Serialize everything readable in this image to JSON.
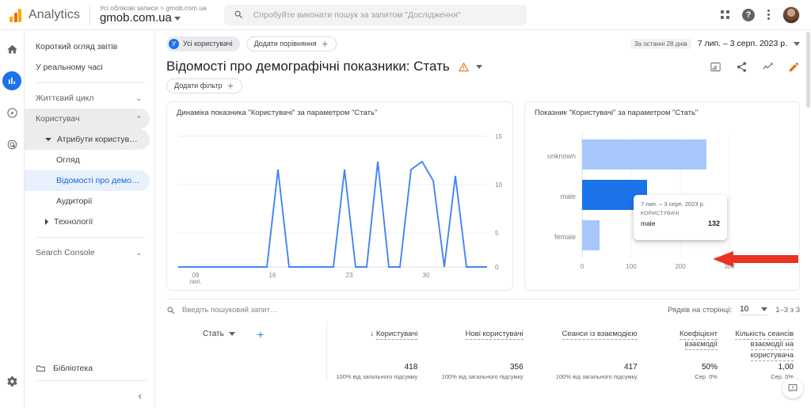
{
  "topbar": {
    "brand": "Analytics",
    "account_crumb": "Усі облікові записи > gmob.com.ua",
    "property": "gmob.com.ua",
    "search_placeholder": "Спробуйте виконати пошук за запитом \"Дослідження\"",
    "search_icon": "search-icon",
    "apps_icon": "apps-grid-icon",
    "help_icon": "help-icon",
    "more_icon": "more-options-icon",
    "avatar": "user-avatar"
  },
  "rail": {
    "items": [
      {
        "name": "home-icon",
        "label": "Головна"
      },
      {
        "name": "reports-icon",
        "label": "Звіти",
        "active": true
      },
      {
        "name": "explore-icon",
        "label": "Дослідження"
      },
      {
        "name": "advertising-icon",
        "label": "Реклама"
      }
    ],
    "settings_icon": "gear-icon"
  },
  "nav": {
    "items": [
      {
        "label": "Короткий огляд звітів",
        "style": "plain"
      },
      {
        "label": "У реальному часі",
        "style": "plain"
      },
      {
        "label": "Життєвий цикл",
        "style": "group",
        "chevron": "⌄"
      },
      {
        "label": "Користувач",
        "style": "group-selected",
        "chevron": "⌃"
      },
      {
        "label": "Атрибути користувача",
        "style": "sub-selected",
        "tri": "down"
      },
      {
        "label": "Огляд",
        "style": "leaf"
      },
      {
        "label": "Відомості про демографіч…",
        "style": "leaf-active"
      },
      {
        "label": "Аудиторії",
        "style": "leaf"
      },
      {
        "label": "Технології",
        "style": "sub",
        "tri": "right"
      },
      {
        "label": "Search Console",
        "style": "group",
        "chevron": "⌄"
      }
    ],
    "library_label": "Бібліотека",
    "library_icon": "folder-icon",
    "collapse_icon": "collapse-left-icon"
  },
  "toolbar": {
    "all_users_chip": "Усі користувачі",
    "all_users_badge": "У",
    "add_comparison": "Додати порівняння",
    "add_comparison_icon": "plus-icon",
    "date_badge": "За останні 28 днів",
    "date_range": "7 лип. – 3 серп. 2023 р.",
    "date_caret": "chevron-down-icon"
  },
  "header": {
    "title": "Відомості про демографічні показники: Стать",
    "warning_icon": "warning-triangle-icon",
    "title_caret": "chevron-down-icon",
    "add_filter": "Додати фільтр",
    "add_filter_icon": "plus-icon",
    "actions": [
      {
        "name": "insights-icon"
      },
      {
        "name": "share-icon"
      },
      {
        "name": "compare-icon"
      },
      {
        "name": "edit-icon"
      }
    ]
  },
  "chart_data": [
    {
      "type": "line",
      "title": "Динаміка показника \"Користувачі\" за параметром \"Стать\"",
      "xlabel": "",
      "ylabel": "",
      "ylim": [
        0,
        15
      ],
      "yticks": [
        0,
        5,
        10,
        15
      ],
      "xticks": [
        "09",
        "16",
        "23",
        "30"
      ],
      "xtick_sub": "лип.",
      "series": [
        {
          "name": "Користувачі",
          "color": "#4285f4",
          "values": [
            0,
            0,
            0,
            0,
            0,
            0,
            0,
            0,
            0,
            10,
            0,
            0,
            0,
            0,
            0,
            10,
            0,
            0,
            11,
            0,
            0,
            10,
            11,
            9,
            0,
            9,
            0,
            0
          ]
        }
      ]
    },
    {
      "type": "bar",
      "title": "Показник \"Користувачі\" за параметром \"Стать\"",
      "orientation": "horizontal",
      "categories": [
        "unknown",
        "male",
        "female"
      ],
      "values": [
        253,
        132,
        35
      ],
      "xlim": [
        0,
        300
      ],
      "xticks": [
        0,
        100,
        200,
        300
      ],
      "colors": [
        "#a8c7fa",
        "#1a73e8",
        "#a8c7fa"
      ],
      "highlighted": "male"
    }
  ],
  "tooltip": {
    "date": "7 лип. – 3 серп. 2023 р.",
    "metric_label": "КОРИСТУВАЧІ",
    "key": "male",
    "value": "132"
  },
  "table": {
    "search_placeholder": "Введіть пошуковий запит…",
    "search_icon": "search-icon",
    "rows_per_page_label": "Рядків на сторінці:",
    "rows_per_page_value": "10",
    "rows_per_page_caret": "chevron-down-icon",
    "range_label": "1–3 з 3",
    "dimension_label": "Стать",
    "dimension_caret": "chevron-down-icon",
    "add_dimension_icon": "plus-icon",
    "columns": [
      {
        "label": "Користувачі",
        "sort_icon": "arrow-down-icon"
      },
      {
        "label": "Нові користувачі"
      },
      {
        "label": "Сеанси із взаємодією"
      },
      {
        "label": "Коефіцієнт взаємодії"
      },
      {
        "label": "Кількість сеансів взаємодії на користувача"
      }
    ],
    "totals_row": [
      {
        "value": "418",
        "sub": "100% від загального підсумку"
      },
      {
        "value": "356",
        "sub": "100% від загального підсумку"
      },
      {
        "value": "417",
        "sub": "100% від загального підсумку"
      },
      {
        "value": "50%",
        "sub": "Сер. 0%"
      },
      {
        "value": "1,00",
        "sub": "Сер. 0%"
      }
    ]
  },
  "feedback": {
    "icon": "feedback-icon"
  },
  "colors": {
    "accent": "#1a73e8",
    "bar_light": "#a8c7fa",
    "line": "#4285f4",
    "warning": "#e8710a",
    "arrow": "#ea3323"
  }
}
